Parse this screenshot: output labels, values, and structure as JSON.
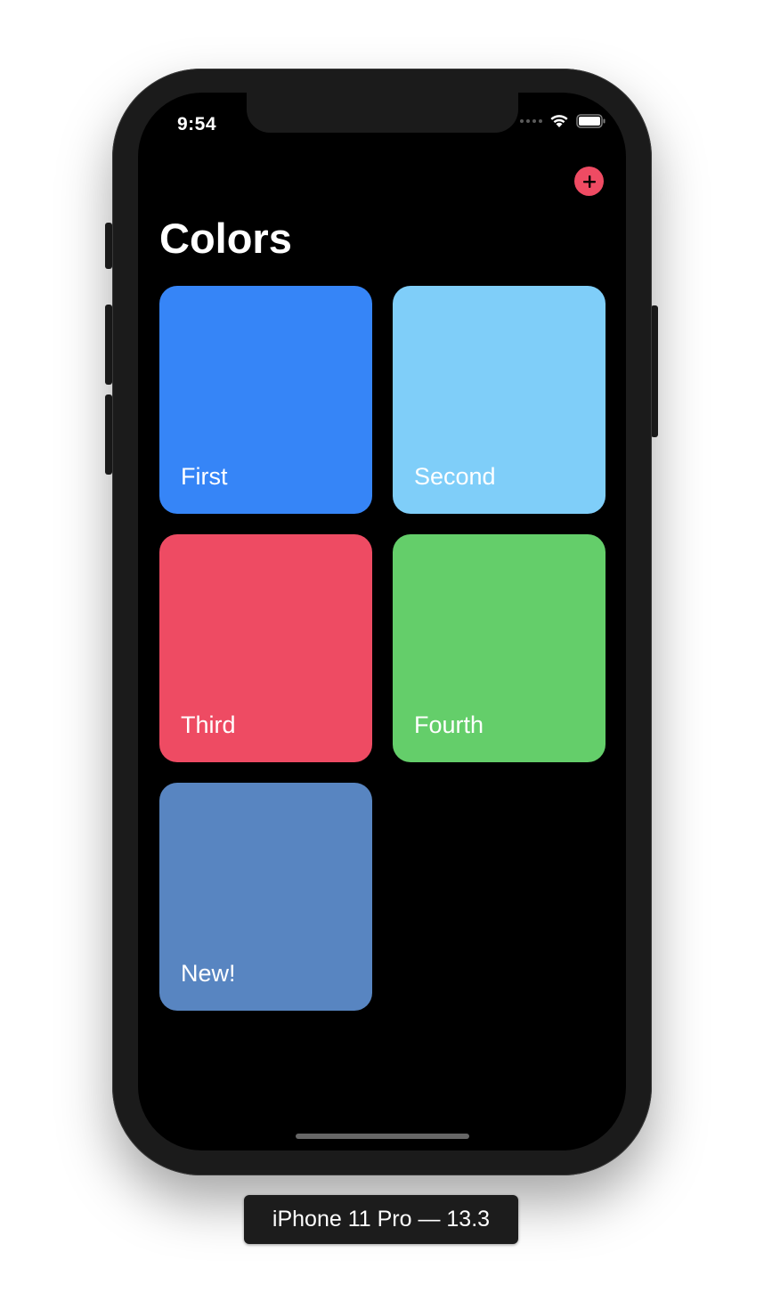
{
  "status_bar": {
    "time": "9:54"
  },
  "nav": {
    "title": "Colors",
    "add_icon": "plus-circle-icon",
    "add_color": "#ef4b63"
  },
  "tiles": [
    {
      "label": "First",
      "color": "#3685f7"
    },
    {
      "label": "Second",
      "color": "#7fcef9"
    },
    {
      "label": "Third",
      "color": "#ee4b63"
    },
    {
      "label": "Fourth",
      "color": "#64ce6a"
    },
    {
      "label": "New!",
      "color": "#5885c1"
    }
  ],
  "device_caption": "iPhone 11 Pro — 13.3"
}
